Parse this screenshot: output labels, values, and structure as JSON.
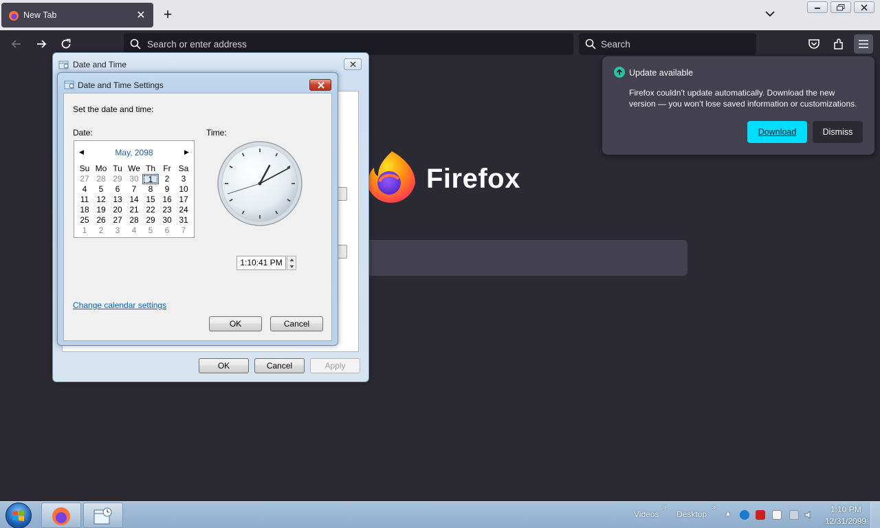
{
  "browser": {
    "tab": {
      "title": "New Tab"
    },
    "urlbar": {
      "placeholder": "Search or enter address"
    },
    "searchbar": {
      "placeholder": "Search"
    },
    "wordmark": "Firefox"
  },
  "update_popup": {
    "title": "Update available",
    "message": "Firefox couldn’t update automatically. Download the new version — you won’t lose saved information or customizations.",
    "download_label": "Download",
    "dismiss_label": "Dismiss"
  },
  "outer_dialog": {
    "title": "Date and Time",
    "ok_label": "OK",
    "cancel_label": "Cancel",
    "apply_label": "Apply"
  },
  "settings_dialog": {
    "title": "Date and Time Settings",
    "instruction": "Set the date and time:",
    "date_label": "Date:",
    "time_label": "Time:",
    "calendar": {
      "month": "May, 2098",
      "weekdays": [
        "Su",
        "Mo",
        "Tu",
        "We",
        "Th",
        "Fr",
        "Sa"
      ],
      "weeks": [
        [
          "27",
          "28",
          "29",
          "30",
          "1",
          "2",
          "3"
        ],
        [
          "4",
          "5",
          "6",
          "7",
          "8",
          "9",
          "10"
        ],
        [
          "11",
          "12",
          "13",
          "14",
          "15",
          "16",
          "17"
        ],
        [
          "18",
          "19",
          "20",
          "21",
          "22",
          "23",
          "24"
        ],
        [
          "25",
          "26",
          "27",
          "28",
          "29",
          "30",
          "31"
        ],
        [
          "1",
          "2",
          "3",
          "4",
          "5",
          "6",
          "7"
        ]
      ],
      "selected_day": "1"
    },
    "time_value": "1:10:41 PM",
    "change_calendar_link": "Change calendar settings",
    "ok_label": "OK",
    "cancel_label": "Cancel"
  },
  "taskbar": {
    "toolbars": [
      "Videos",
      "Desktop"
    ],
    "clock_time": "1:10 PM",
    "clock_date": "12/31/2099"
  },
  "colors": {
    "accent_cyan": "#00ddff",
    "update_green": "#2ac3a2",
    "link_blue": "#0066cc"
  }
}
